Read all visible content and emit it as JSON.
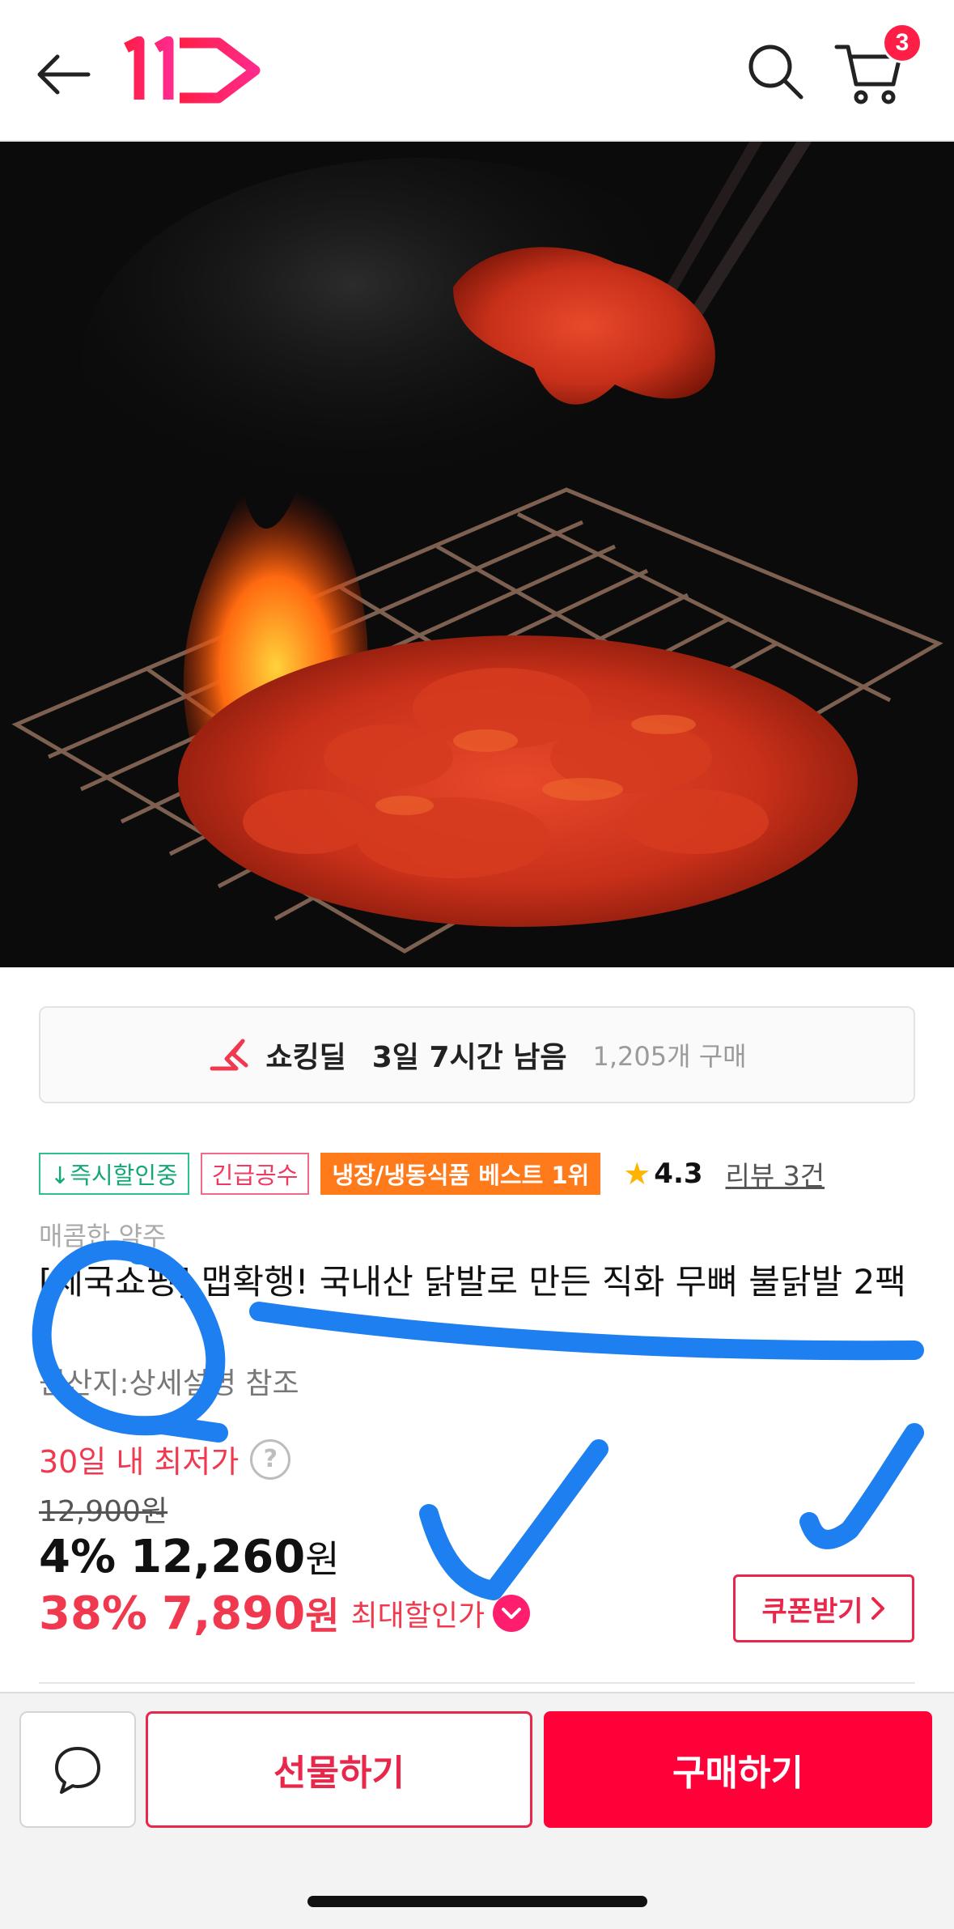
{
  "header": {
    "back_icon": "arrow-left-icon",
    "logo_text": "11",
    "search_icon": "search-icon",
    "cart_icon": "cart-icon",
    "cart_count": "3",
    "brand_colors": {
      "logo_start": "#ff1e46",
      "logo_end": "#ff2a8a"
    }
  },
  "hero": {
    "image_alt": "grilled spicy boneless chicken feet"
  },
  "deal": {
    "icon": "shocking-deal-icon",
    "name": "쇼킹딜",
    "time_left": "3일 7시간 남음",
    "purchase_count": "1,205개 구매"
  },
  "badges": [
    {
      "label": "↓즉시할인중",
      "style": "green"
    },
    {
      "label": "긴급공수",
      "style": "pink"
    },
    {
      "label": "냉장/냉동식품 베스트 1위",
      "style": "orange"
    }
  ],
  "rating": {
    "value": "4.3",
    "review_label": "리뷰 3건"
  },
  "product": {
    "brand": "매콤한 약주",
    "title": "[제국쇼핑] 맵확행! 국내산 닭발로 만든 직화 무뼈 불닭발 2팩",
    "origin": "원산지:상세설명 참조"
  },
  "pricing": {
    "lowest_label": "30일 내 최저가",
    "original_price": "12,900원",
    "discount_pct": "4%",
    "discount_price": "12,260",
    "won": "원",
    "max_pct": "38%",
    "max_price": "7,890",
    "max_label": "최대할인가",
    "coupon_label": "쿠폰받기"
  },
  "bottom_bar": {
    "chat_icon": "chat-bubble-icon",
    "gift_label": "선물하기",
    "buy_label": "구매하기"
  },
  "accent_colors": {
    "primary_red": "#ff0038",
    "text_red": "#f0394f",
    "annotation_blue": "#1e7ff0"
  }
}
